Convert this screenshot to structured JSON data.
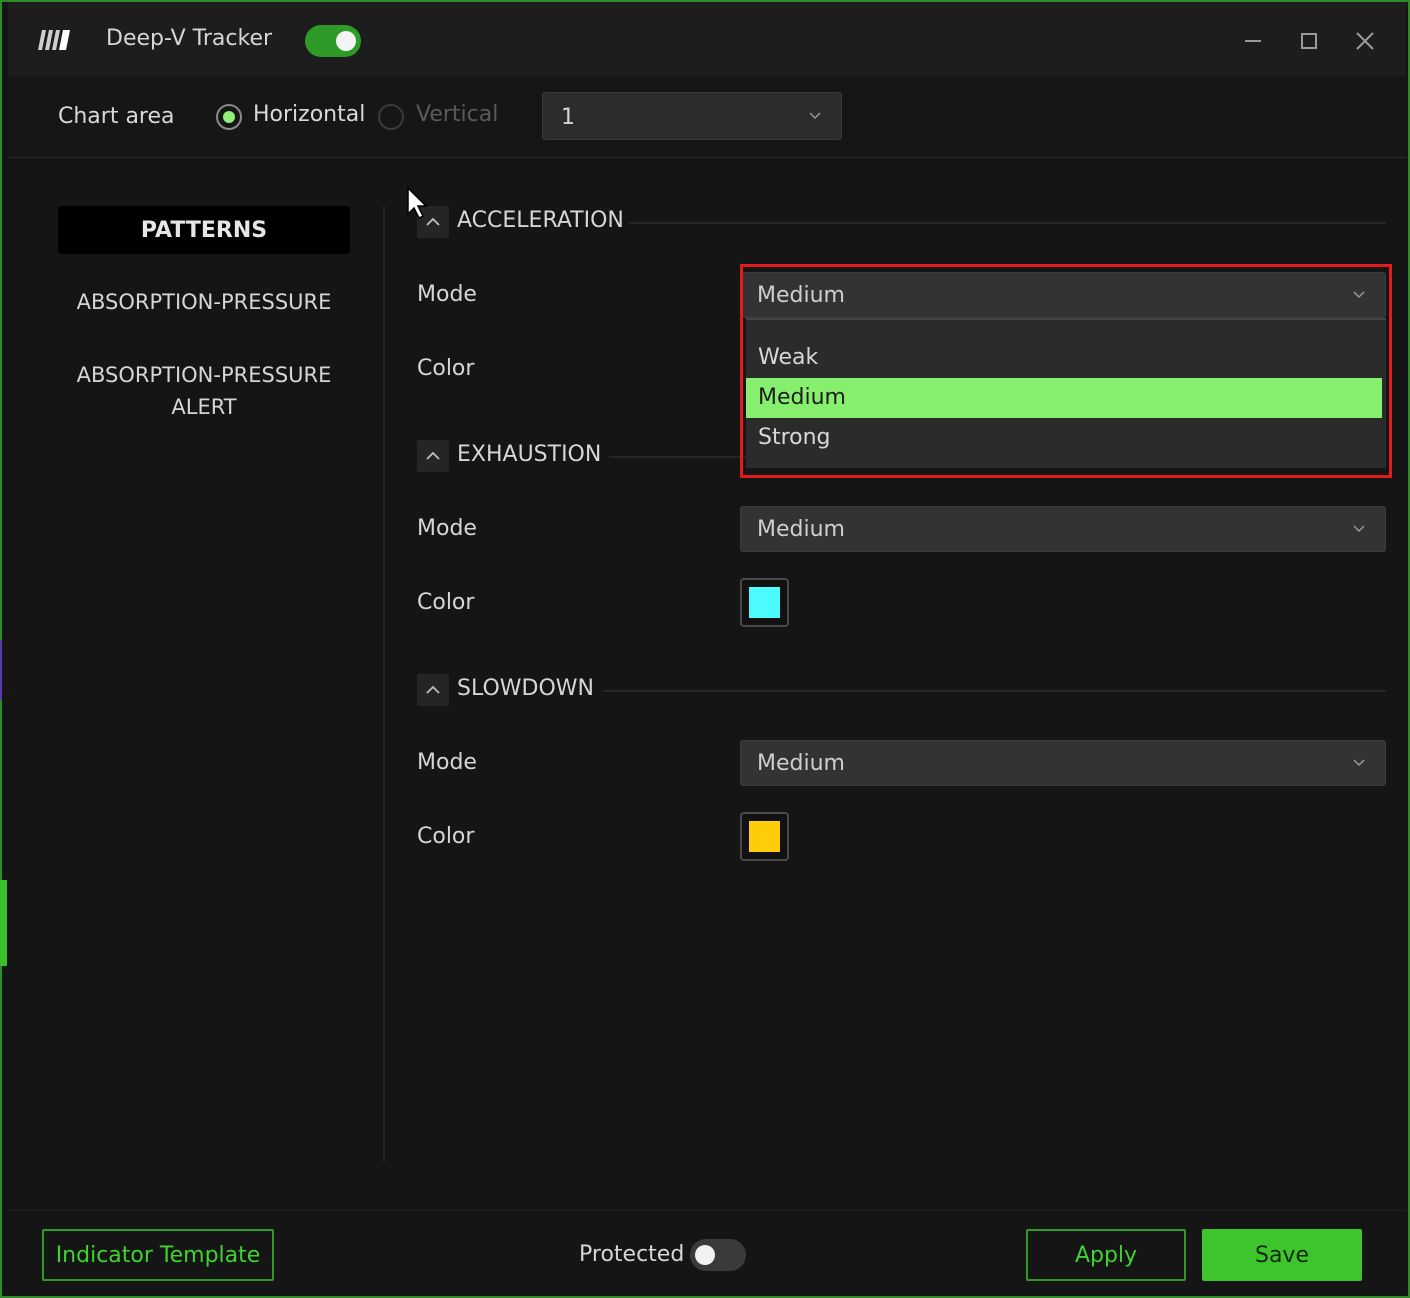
{
  "app": {
    "title": "Deep-V Tracker",
    "enabled": true
  },
  "chart_area": {
    "label": "Chart area",
    "options": [
      "Horizontal",
      "Vertical"
    ],
    "selected": "Horizontal",
    "value": "1"
  },
  "sidebar": {
    "active": "PATTERNS",
    "items": [
      "ABSORPTION-PRESSURE",
      "ABSORPTION-PRESSURE ALERT"
    ]
  },
  "sections": [
    {
      "title": "ACCELERATION",
      "mode_label": "Mode",
      "mode_value": "Medium",
      "color_label": "Color",
      "dropdown_open": true,
      "dropdown_options": [
        "Weak",
        "Medium",
        "Strong"
      ],
      "dropdown_selected": "Medium"
    },
    {
      "title": "EXHAUSTION",
      "mode_label": "Mode",
      "mode_value": "Medium",
      "color_label": "Color",
      "color": "#4dfbff"
    },
    {
      "title": "SLOWDOWN",
      "mode_label": "Mode",
      "mode_value": "Medium",
      "color_label": "Color",
      "color": "#ffcc0a"
    }
  ],
  "footer": {
    "template_label": "Indicator Template",
    "protected_label": "Protected",
    "protected_on": false,
    "apply_label": "Apply",
    "save_label": "Save"
  },
  "theme": {
    "accent": "#3ec42c",
    "highlight_option": "#86f06e",
    "focus_border": "#e21b1b"
  }
}
